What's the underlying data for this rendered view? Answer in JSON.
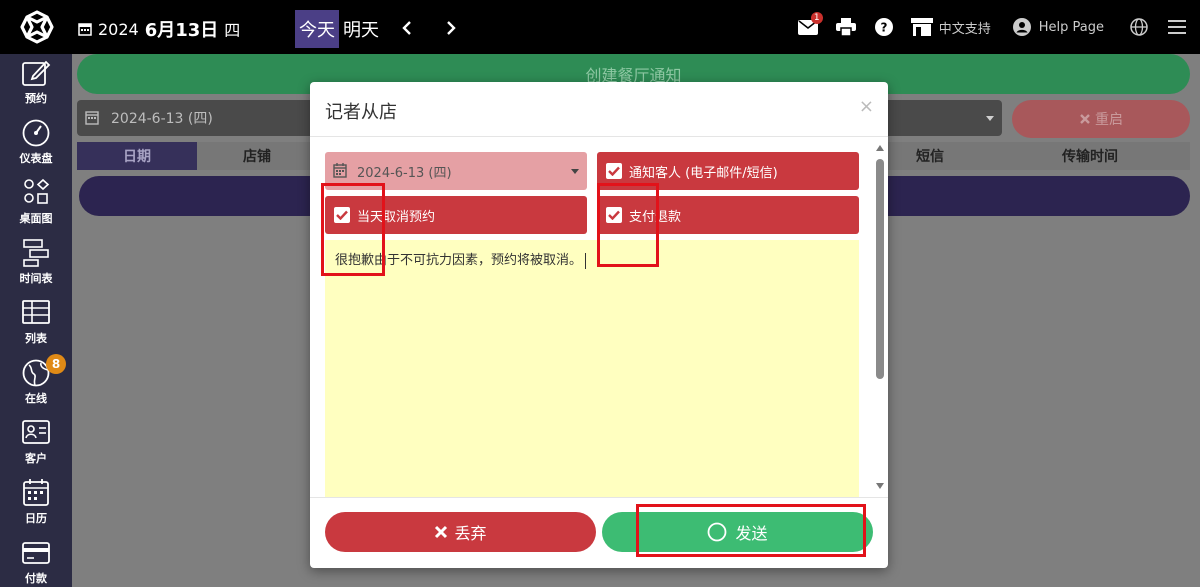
{
  "topbar": {
    "year": "2024",
    "date": "6月13日",
    "weekday": "四",
    "today_label": "今天",
    "tomorrow_label": "明天",
    "mail_count": "1",
    "language_support_label": "中文支持",
    "help_label": "Help Page"
  },
  "sidebar": {
    "items": [
      {
        "label": "预约",
        "icon": "edit-icon"
      },
      {
        "label": "仪表盘",
        "icon": "dashboard-icon"
      },
      {
        "label": "桌面图",
        "icon": "table-map-icon"
      },
      {
        "label": "时间表",
        "icon": "timeline-icon"
      },
      {
        "label": "列表",
        "icon": "list-icon"
      },
      {
        "label": "在线",
        "icon": "globe-icon",
        "badge": "8"
      },
      {
        "label": "客户",
        "icon": "contact-card-icon"
      },
      {
        "label": "日历",
        "icon": "calendar-icon"
      },
      {
        "label": "付款",
        "icon": "credit-card-icon"
      }
    ]
  },
  "main": {
    "create_notice_label": "创建餐厅通知",
    "date_filter_value": "2024-6-13 (四)",
    "restart_label": "重启",
    "columns": [
      "日期",
      "店铺",
      "短信",
      "传输时间"
    ]
  },
  "modal": {
    "title": "记者从店",
    "close_symbol": "×",
    "date_value": "2024-6-13 (四)",
    "notify_guest_label": "通知客人 (电子邮件/短信)",
    "cancel_today_label": "当天取消预约",
    "refund_label": "支付退款",
    "message_text": "很抱歉由于不可抗力因素，预约将被取消。",
    "discard_label": "丢弃",
    "send_label": "发送"
  },
  "colors": {
    "brand_green": "#3dbc73",
    "danger_red": "#c9393f",
    "sidebar_bg": "#2c2c44",
    "highlight_red": "#e2121a",
    "message_bg": "#ffffc0"
  }
}
